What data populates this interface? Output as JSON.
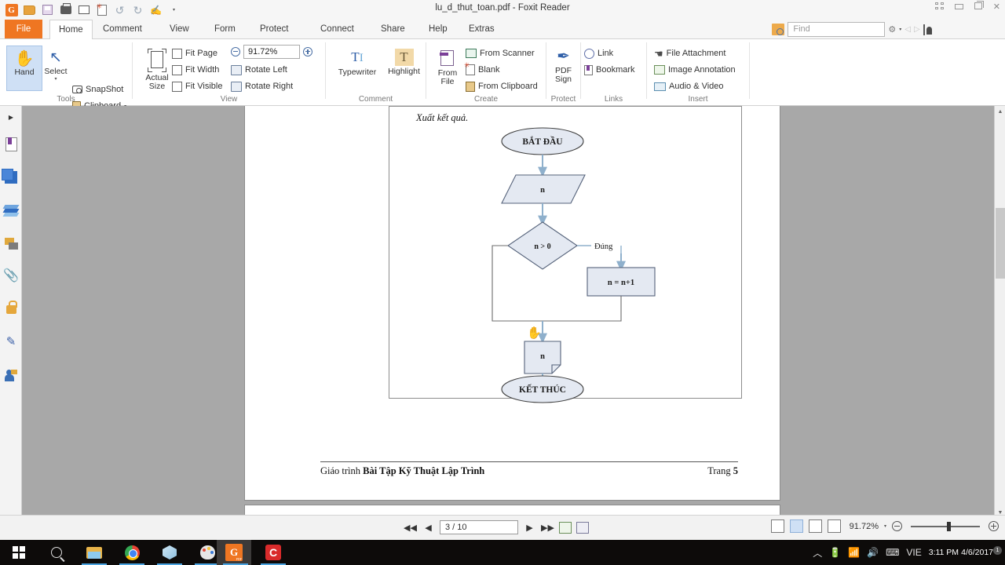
{
  "window": {
    "title": "lu_d_thut_toan.pdf - Foxit Reader",
    "restore_icon": "restore-grid-icon",
    "minimize_icon": "minimize-icon",
    "maximize_icon": "maximize-icon",
    "close_icon": "close-icon"
  },
  "quick_access": [
    {
      "name": "foxit-logo",
      "icon": "foxit-logo-icon",
      "glyph": "G"
    },
    {
      "name": "open",
      "icon": "open-folder-icon"
    },
    {
      "name": "save",
      "icon": "save-disk-icon"
    },
    {
      "name": "print",
      "icon": "printer-icon"
    },
    {
      "name": "email",
      "icon": "email-icon"
    },
    {
      "name": "new-blank",
      "icon": "new-document-icon"
    },
    {
      "name": "undo",
      "icon": "undo-icon",
      "glyph": "↺"
    },
    {
      "name": "redo",
      "icon": "redo-icon",
      "glyph": "↻"
    },
    {
      "name": "stamp",
      "icon": "stamp-icon",
      "glyph": "✍"
    },
    {
      "name": "customize",
      "icon": "chevron-down-icon",
      "glyph": "▾"
    }
  ],
  "tabs": [
    {
      "label": "File",
      "active": false,
      "kind": "file"
    },
    {
      "label": "Home",
      "active": true
    },
    {
      "label": "Comment",
      "active": false
    },
    {
      "label": "View",
      "active": false
    },
    {
      "label": "Form",
      "active": false
    },
    {
      "label": "Protect",
      "active": false
    },
    {
      "label": "Connect",
      "active": false
    },
    {
      "label": "Share",
      "active": false
    },
    {
      "label": "Help",
      "active": false
    },
    {
      "label": "Extras",
      "active": false
    }
  ],
  "search": {
    "placeholder": "Find",
    "value": "",
    "icon": "find-highlight-icon",
    "magnifier_icon": "magnifier-icon",
    "settings_icon": "gear-icon",
    "prev_icon": "previous-result-icon",
    "next_icon": "next-result-icon",
    "account_icon": "account-icon"
  },
  "ribbon": {
    "groups": [
      {
        "name": "tools",
        "label": "Tools",
        "big_buttons": [
          {
            "label": "Hand",
            "icon": "hand-icon",
            "glyph": "✋",
            "selected": true
          },
          {
            "label": "Select",
            "icon": "select-cursor-icon",
            "glyph": "↖",
            "selected": false,
            "has_dropdown": true
          }
        ],
        "small_buttons": [
          {
            "label": "SnapShot",
            "icon": "camera-icon"
          },
          {
            "label": "Clipboard",
            "icon": "clipboard-icon",
            "has_dropdown": true
          }
        ]
      },
      {
        "name": "view",
        "label": "View",
        "big_buttons": [
          {
            "label": "Actual Size",
            "icon": "actual-size-icon"
          }
        ],
        "small_buttons": [
          {
            "label": "Fit Page",
            "icon": "fit-page-icon"
          },
          {
            "label": "Fit Width",
            "icon": "fit-width-icon"
          },
          {
            "label": "Fit Visible",
            "icon": "fit-visible-icon"
          },
          {
            "label": "Rotate Left",
            "icon": "rotate-left-icon"
          },
          {
            "label": "Rotate Right",
            "icon": "rotate-right-icon"
          }
        ],
        "zoom": {
          "value": "91.72%",
          "zoom_out_icon": "zoom-out-icon",
          "zoom_in_icon": "zoom-in-icon"
        }
      },
      {
        "name": "comment",
        "label": "Comment",
        "big_buttons": [
          {
            "label": "Typewriter",
            "icon": "typewriter-icon"
          },
          {
            "label": "Highlight",
            "icon": "highlight-icon"
          }
        ],
        "small_buttons": []
      },
      {
        "name": "create",
        "label": "Create",
        "big_buttons": [
          {
            "label": "From File",
            "icon": "from-file-icon"
          }
        ],
        "small_buttons": [
          {
            "label": "From Scanner",
            "icon": "scanner-icon"
          },
          {
            "label": "Blank",
            "icon": "blank-page-icon"
          },
          {
            "label": "From Clipboard",
            "icon": "clipboard-paste-icon"
          }
        ]
      },
      {
        "name": "protect",
        "label": "Protect",
        "big_buttons": [
          {
            "label": "PDF Sign",
            "icon": "pdf-sign-icon"
          }
        ],
        "small_buttons": []
      },
      {
        "name": "links",
        "label": "Links",
        "big_buttons": [],
        "small_buttons": [
          {
            "label": "Link",
            "icon": "link-globe-icon"
          },
          {
            "label": "Bookmark",
            "icon": "bookmark-icon"
          }
        ]
      },
      {
        "name": "insert",
        "label": "Insert",
        "big_buttons": [],
        "small_buttons": [
          {
            "label": "File Attachment",
            "icon": "file-attachment-icon"
          },
          {
            "label": "Image Annotation",
            "icon": "image-annotation-icon"
          },
          {
            "label": "Audio & Video",
            "icon": "audio-video-icon"
          }
        ]
      }
    ]
  },
  "left_nav": [
    {
      "name": "expand-panel",
      "icon": "caret-right-icon"
    },
    {
      "name": "bookmarks-panel",
      "icon": "bookmark-panel-icon"
    },
    {
      "name": "pages-panel",
      "icon": "page-thumbnails-icon"
    },
    {
      "name": "layers-panel",
      "icon": "layers-icon"
    },
    {
      "name": "comments-panel",
      "icon": "comments-icon"
    },
    {
      "name": "attachments-panel",
      "icon": "paperclip-icon"
    },
    {
      "name": "security-panel",
      "icon": "lock-icon"
    },
    {
      "name": "signatures-panel",
      "icon": "signature-icon"
    },
    {
      "name": "shared-review-panel",
      "icon": "user-comment-icon"
    }
  ],
  "document": {
    "heading": "Xuất kết quả.",
    "footer": {
      "left_normal": "Giáo trình ",
      "left_bold": "Bài Tập Kỹ Thuật Lập Trình",
      "right_normal": "Trang ",
      "right_bold": "5"
    },
    "flowchart": {
      "start_label": "BẮT ĐẦU",
      "input_label": "n",
      "decision_label": "n > 0",
      "yes_label": "Đúng",
      "process_label": "n = n+1",
      "output_label": "n",
      "end_label": "KẾT THÚC",
      "shape_fill": "#e4e9f2",
      "shape_stroke": "#55627a",
      "arrow_color": "#8fb0cc"
    }
  },
  "status_bar": {
    "first_page_icon": "first-page-icon",
    "prev_page_icon": "previous-page-icon",
    "page_value": "3 / 10",
    "next_page_icon": "next-page-icon",
    "last_page_icon": "last-page-icon",
    "fit_icon": "fit-page-status-icon",
    "reflow_icon": "reflow-status-icon",
    "view_modes": [
      {
        "name": "single-page-view",
        "icon": "single-page-icon",
        "active": false
      },
      {
        "name": "continuous-view",
        "icon": "continuous-page-icon",
        "active": true
      },
      {
        "name": "facing-view",
        "icon": "facing-page-icon",
        "active": false
      },
      {
        "name": "continuous-facing-view",
        "icon": "continuous-facing-icon",
        "active": false
      }
    ],
    "zoom_value": "91.72%",
    "zoom_out_icon": "zoom-out-circle-icon",
    "zoom_in_icon": "zoom-in-circle-icon"
  },
  "taskbar": {
    "items": [
      {
        "name": "start-button",
        "icon": "windows-logo-icon"
      },
      {
        "name": "search-button",
        "icon": "search-icon"
      },
      {
        "name": "file-explorer",
        "icon": "folder-icon",
        "running": true
      },
      {
        "name": "google-chrome",
        "icon": "chrome-icon",
        "running": true
      },
      {
        "name": "microsoft-store",
        "icon": "store-icon",
        "running": true
      },
      {
        "name": "paint",
        "icon": "paint-palette-icon",
        "running": true
      },
      {
        "name": "foxit-reader",
        "icon": "foxit-pdf-icon",
        "glyph": "G",
        "running": true,
        "active": true
      },
      {
        "name": "camtasia",
        "icon": "camtasia-icon",
        "glyph": "C",
        "running": true
      }
    ],
    "tray": {
      "chevron_icon": "show-hidden-icons-icon",
      "battery_icon": "battery-icon",
      "wifi_icon": "wifi-icon",
      "volume_icon": "volume-icon",
      "keyboard_icon": "keyboard-icon",
      "language": "VIE",
      "time": "3:11 PM",
      "date": "4/6/2017",
      "notification_icon": "action-center-icon",
      "notification_count": "1"
    }
  }
}
